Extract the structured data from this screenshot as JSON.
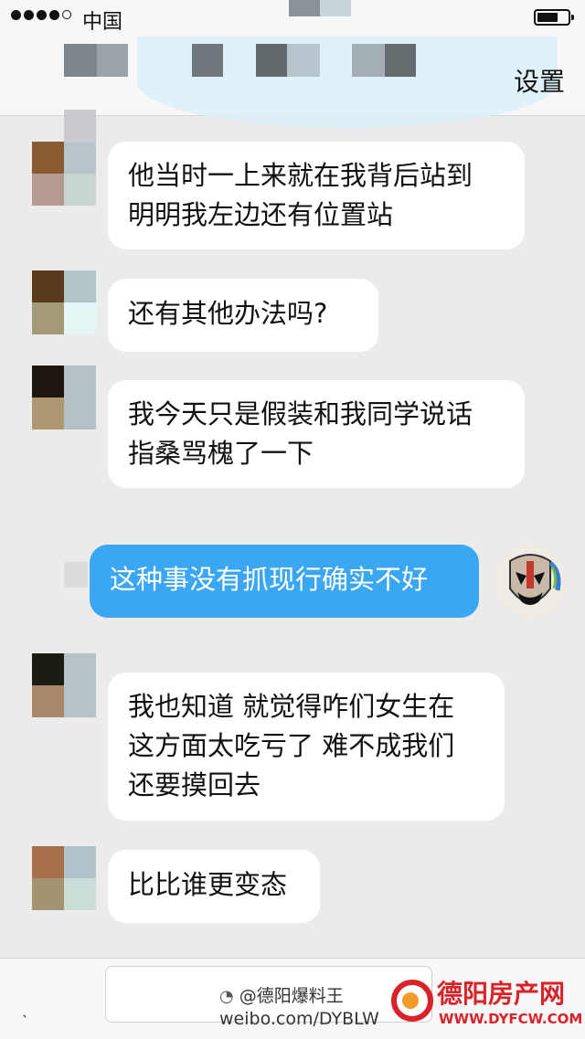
{
  "status_bar": {
    "carrier": "中国",
    "signal_icon": "signal-dots-icon",
    "battery_icon": "battery-icon"
  },
  "nav": {
    "settings_label": "设置"
  },
  "messages": [
    {
      "direction": "in",
      "text": "他当时一上来就在我背后站到\n明明我左边还有位置站"
    },
    {
      "direction": "in",
      "text": "还有其他办法吗?"
    },
    {
      "direction": "in",
      "text": "我今天只是假装和我同学说话\n指桑骂槐了一下"
    },
    {
      "direction": "out",
      "text": "这种事没有抓现行确实不好"
    },
    {
      "direction": "in",
      "text": "我也知道 就觉得咋们女生在\n这方面太吃亏了 难不成我们\n还要摸回去"
    },
    {
      "direction": "in",
      "text": "比比谁更变态"
    }
  ],
  "input": {
    "placeholder": ""
  },
  "watermark": {
    "weibo_name": "@德阳爆料王",
    "weibo_url": "weibo.com/DYBLW",
    "logo_text": "德阳房产网",
    "logo_url": "WWW.DYFCW.COM"
  },
  "colors": {
    "outgoing_bubble": "#3ba6f2",
    "incoming_bubble": "#ffffff",
    "background": "#ebebeb"
  }
}
